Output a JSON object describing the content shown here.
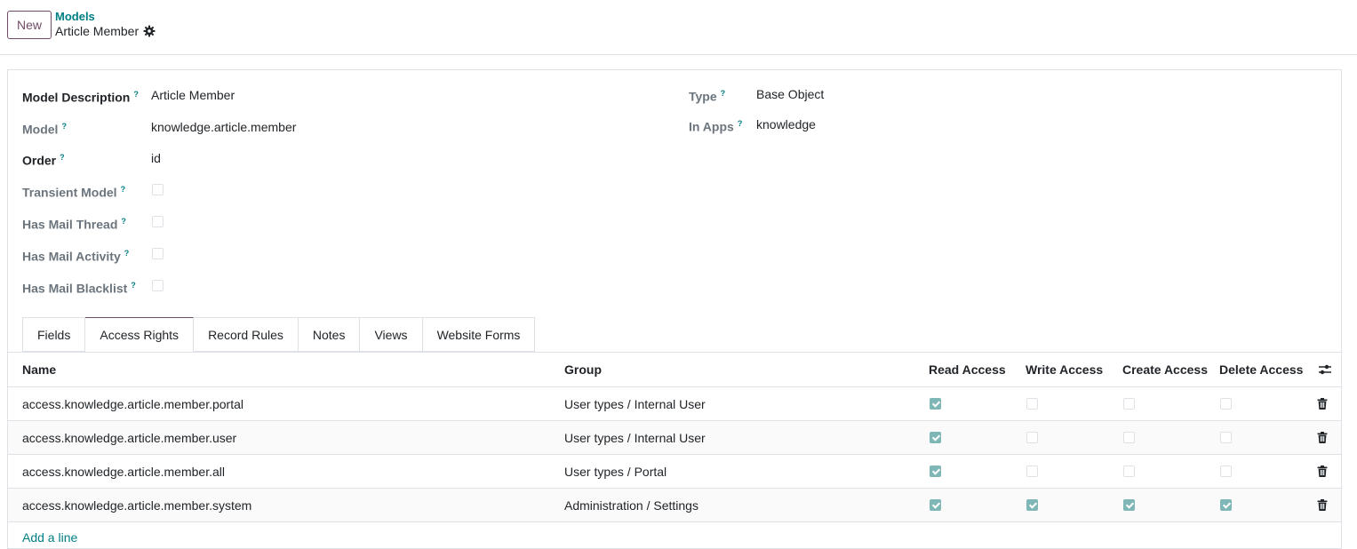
{
  "control_panel": {
    "new_label": "New",
    "breadcrumb_parent": "Models",
    "record_title": "Article Member"
  },
  "form": {
    "model_description": {
      "label": "Model Description",
      "value": "Article Member"
    },
    "model": {
      "label": "Model",
      "value": "knowledge.article.member"
    },
    "order": {
      "label": "Order",
      "value": "id"
    },
    "transient_model": {
      "label": "Transient Model",
      "checked": false
    },
    "has_mail_thread": {
      "label": "Has Mail Thread",
      "checked": false
    },
    "has_mail_activity": {
      "label": "Has Mail Activity",
      "checked": false
    },
    "has_mail_blacklist": {
      "label": "Has Mail Blacklist",
      "checked": false
    },
    "type": {
      "label": "Type",
      "value": "Base Object"
    },
    "in_apps": {
      "label": "In Apps",
      "value": "knowledge"
    },
    "tooltip_mark": "?"
  },
  "tabs": [
    {
      "label": "Fields",
      "active": false
    },
    {
      "label": "Access Rights",
      "active": true
    },
    {
      "label": "Record Rules",
      "active": false
    },
    {
      "label": "Notes",
      "active": false
    },
    {
      "label": "Views",
      "active": false
    },
    {
      "label": "Website Forms",
      "active": false
    }
  ],
  "access_table": {
    "columns": [
      "Name",
      "Group",
      "Read Access",
      "Write Access",
      "Create Access",
      "Delete Access"
    ],
    "rows": [
      {
        "name": "access.knowledge.article.member.portal",
        "group": "User types / Internal User",
        "read": true,
        "write": false,
        "create": false,
        "delete": false
      },
      {
        "name": "access.knowledge.article.member.user",
        "group": "User types / Internal User",
        "read": true,
        "write": false,
        "create": false,
        "delete": false
      },
      {
        "name": "access.knowledge.article.member.all",
        "group": "User types / Portal",
        "read": true,
        "write": false,
        "create": false,
        "delete": false
      },
      {
        "name": "access.knowledge.article.member.system",
        "group": "Administration / Settings",
        "read": true,
        "write": true,
        "create": true,
        "delete": true
      }
    ],
    "add_line_label": "Add a line"
  },
  "colors": {
    "brand": "#714b67",
    "link": "#017e84",
    "checked": "#7fb7b6",
    "border": "#dee2e6"
  },
  "icons": {
    "gear": "gear-icon",
    "settings_toggle": "sliders-icon",
    "delete": "trash-icon"
  }
}
